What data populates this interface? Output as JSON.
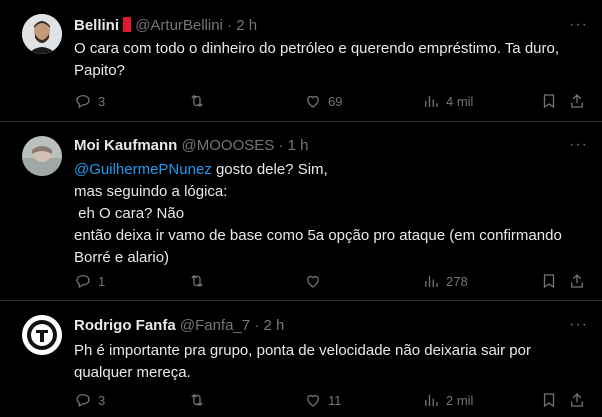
{
  "tweets": [
    {
      "name": "Bellini",
      "handle": "@ArturBellini",
      "time": "2 h",
      "lines": [
        "O cara com todo o dinheiro do petróleo e querendo empréstimo. Ta duro,",
        "Papito?"
      ],
      "replies": "3",
      "retweets": "",
      "likes": "69",
      "views": "4 mil"
    },
    {
      "name": "Moi Kaufmann",
      "handle": "@MOOOSES",
      "time": "1 h",
      "mention": "@GuilhermePNunez",
      "first_line_rest": " gosto dele? Sim,",
      "lines": [
        "mas seguindo a lógica:",
        " eh O cara? Não",
        "então deixa ir vamo de base como 5a opção pro ataque (em confirmando",
        "Borré e alario)"
      ],
      "replies": "1",
      "retweets": "",
      "likes": "",
      "views": "278"
    },
    {
      "name": "Rodrigo Fanfa",
      "handle": "@Fanfa_7",
      "time": "2 h",
      "lines": [
        "Ph é importante pra grupo, ponta de velocidade não deixaria sair por",
        "qualquer mereça."
      ],
      "replies": "3",
      "retweets": "",
      "likes": "11",
      "views": "2 mil"
    }
  ],
  "ui": {
    "dot": "·",
    "more": "···"
  }
}
